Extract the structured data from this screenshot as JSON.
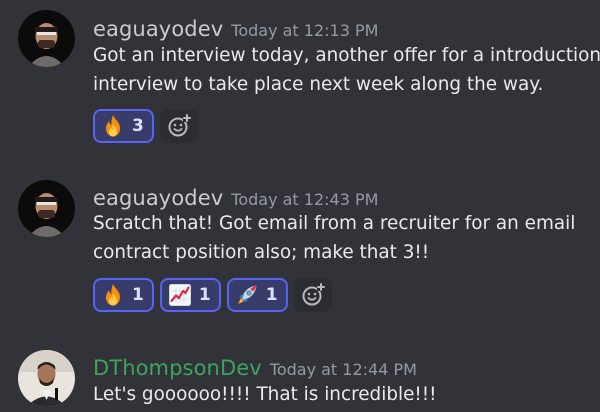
{
  "messages": [
    {
      "username": "eaguayodev",
      "timestamp": "Today at 12:13 PM",
      "lines": [
        "Got an interview today, another offer for a introduction",
        "interview to take place next week along the way."
      ],
      "reactions": [
        {
          "emoji": "fire",
          "count": "3"
        }
      ]
    },
    {
      "username": "eaguayodev",
      "timestamp": "Today at 12:43 PM",
      "lines": [
        "Scratch that! Got email from a recruiter for an email",
        "contract position also; make that 3!!"
      ],
      "reactions": [
        {
          "emoji": "fire",
          "count": "1"
        },
        {
          "emoji": "chart-increasing",
          "count": "1"
        },
        {
          "emoji": "rocket",
          "count": "1"
        }
      ]
    },
    {
      "username": "DThompsonDev",
      "username_color": "#3ba55c",
      "timestamp": "Today at 12:44 PM",
      "lines": [
        "Let's goooooo!!!! That is incredible!!!"
      ]
    }
  ],
  "colors": {
    "background": "#313338",
    "reaction_active_border": "#5865f2",
    "reaction_active_bg": "#373c6b",
    "username_default": "#c7ccd1",
    "timestamp": "#949ba4"
  },
  "icons": {
    "add_reaction": "smile-plus-icon"
  }
}
